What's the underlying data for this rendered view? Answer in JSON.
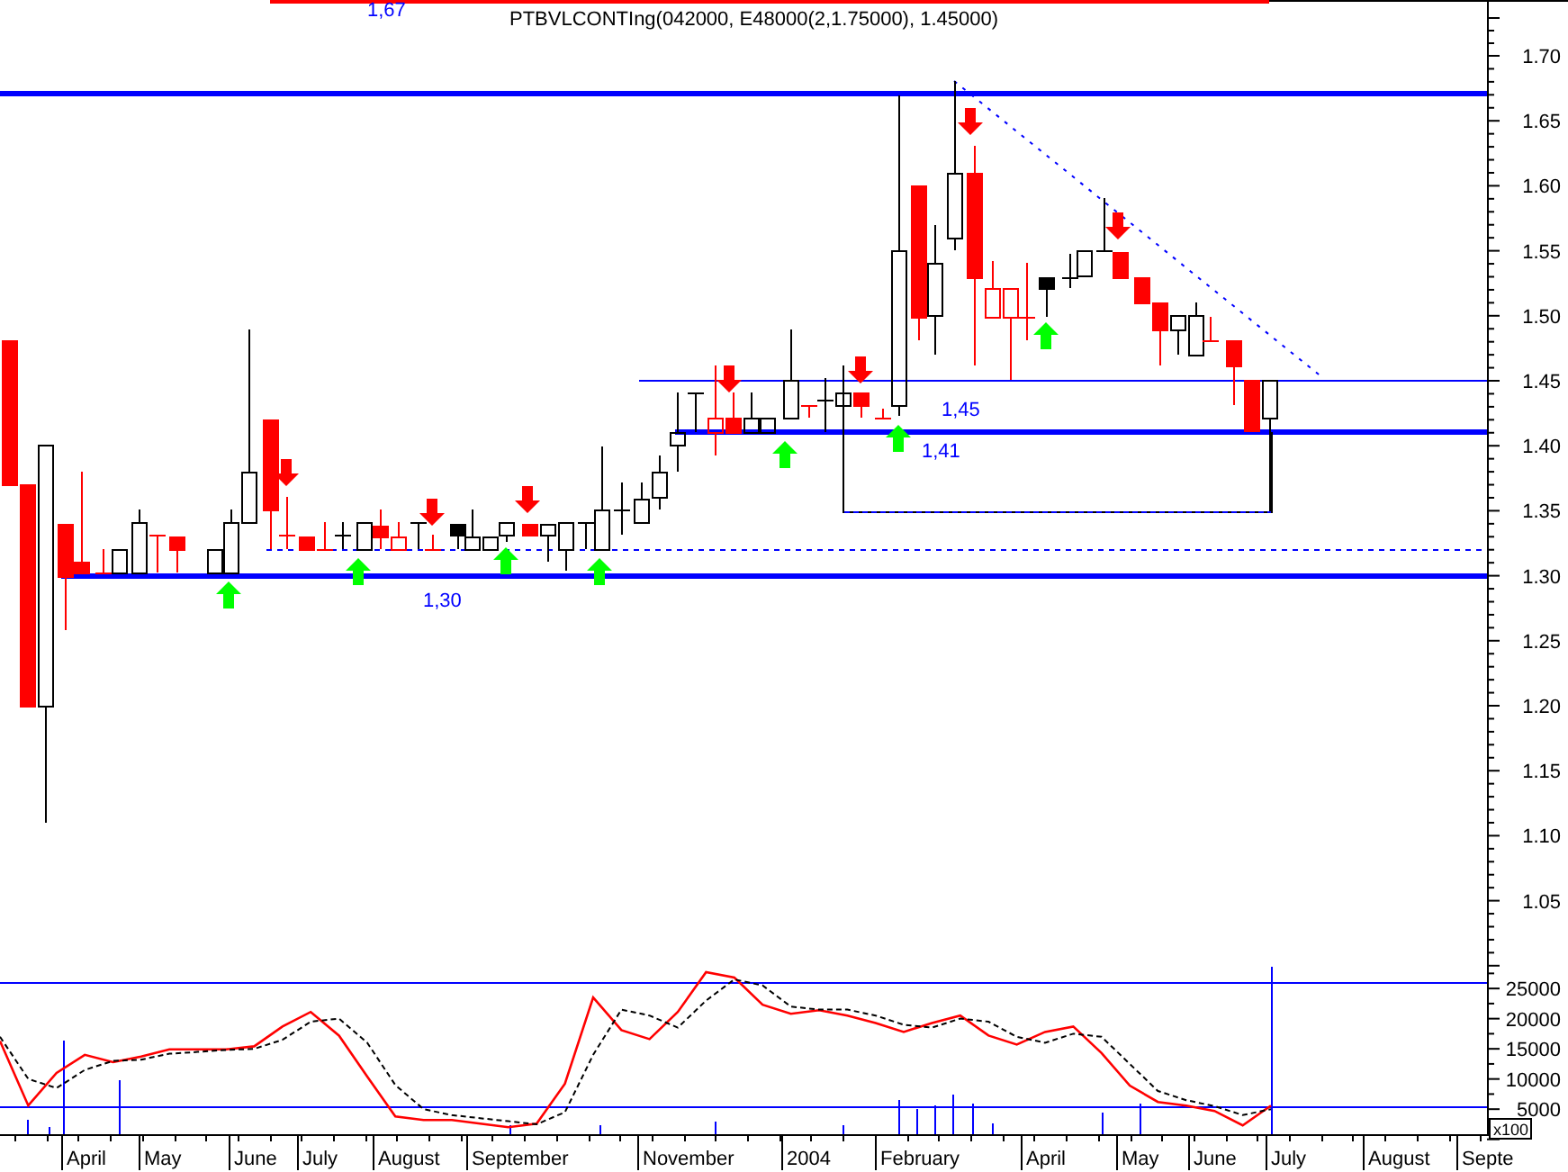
{
  "chart_title": "PTBVLCONTIng(042000, E48000(2,1.75000), 1.45000)",
  "price_chart": {
    "price_axis": [
      "1.70",
      "1.65",
      "1.60",
      "1.55",
      "1.50",
      "1.45",
      "1.40",
      "1.35",
      "1.30",
      "1.25",
      "1.20",
      "1.15",
      "1.10",
      "1.05"
    ],
    "line_labels": [
      "1,67",
      "1,45",
      "1,41",
      "1,30"
    ]
  },
  "indicator_panel": {
    "axis_labels": [
      "25000",
      "20000",
      "15000",
      "10000",
      "5000"
    ],
    "scale_label": "x100"
  },
  "time_axis": [
    "April",
    "May",
    "June",
    "July",
    "August",
    "September",
    "November",
    "2004",
    "February",
    "April",
    "May",
    "June",
    "July",
    "August",
    "Septe"
  ]
}
